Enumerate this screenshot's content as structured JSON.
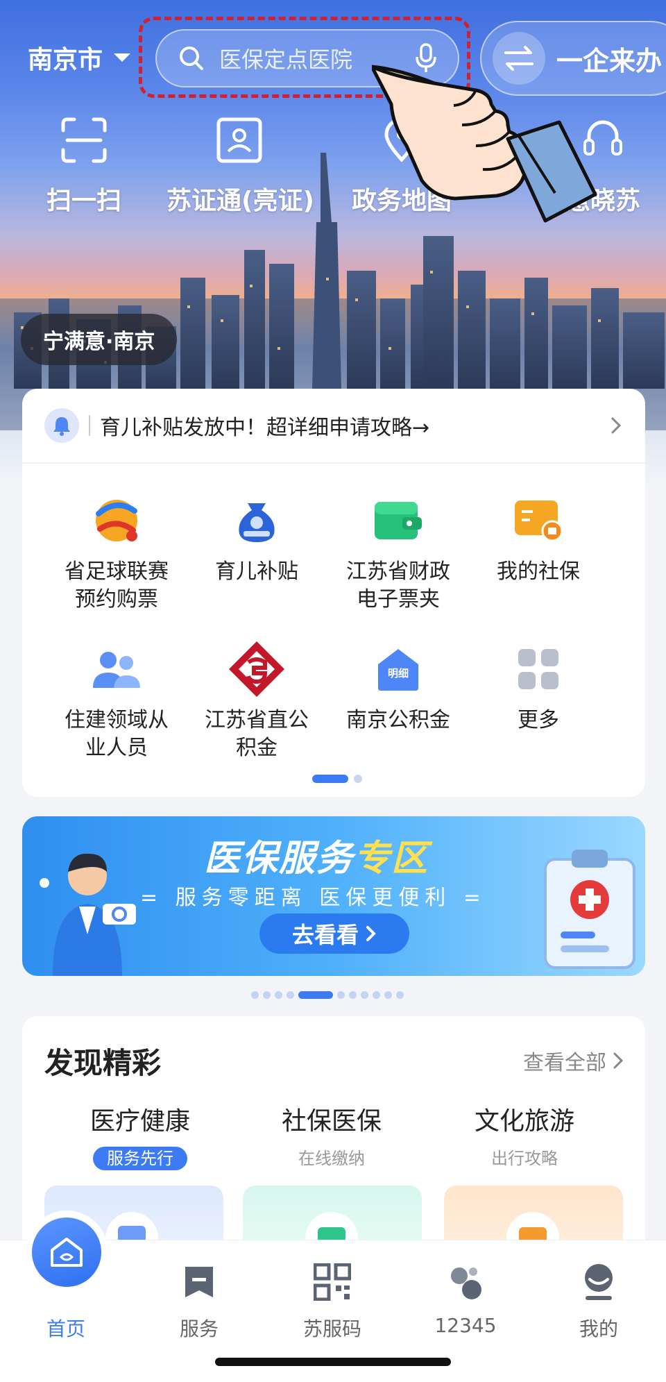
{
  "header": {
    "city": "南京市",
    "search_placeholder": "医保定点医院",
    "enterprise_label": "一企来办"
  },
  "quick_actions": [
    {
      "label": "扫一扫",
      "icon": "scan-icon"
    },
    {
      "label": "苏证通(亮证)",
      "icon": "id-card-icon"
    },
    {
      "label": "政务地图",
      "icon": "map-pin-icon"
    },
    {
      "label": "慧晓苏",
      "icon": "assistant-icon"
    }
  ],
  "slogan": "宁满意·南京",
  "notice": {
    "text": "育儿补贴发放中！超详细申请攻略→"
  },
  "services": [
    {
      "label": "省足球联赛\n预约购票",
      "icon": "football-league-icon"
    },
    {
      "label": "育儿补贴",
      "icon": "childcare-subsidy-icon"
    },
    {
      "label": "江苏省财政\n电子票夹",
      "icon": "wallet-icon"
    },
    {
      "label": "我的社保",
      "icon": "social-security-icon"
    },
    {
      "label": "住建领域从\n业人员",
      "icon": "people-icon"
    },
    {
      "label": "江苏省直公\n积金",
      "icon": "provident-fund-logo-icon"
    },
    {
      "label": "南京公积金",
      "icon": "house-details-icon"
    },
    {
      "label": "更多",
      "icon": "more-grid-icon"
    }
  ],
  "banner": {
    "title_main": "医保服务",
    "title_highlight": "专区",
    "subtitle": "服务零距离  医保更便利",
    "button": "去看看"
  },
  "discover": {
    "title": "发现精彩",
    "view_all": "查看全部",
    "categories": [
      {
        "name": "医疗健康",
        "sub": "服务先行"
      },
      {
        "name": "社保医保",
        "sub": "在线缴纳"
      },
      {
        "name": "文化旅游",
        "sub": "出行攻略"
      }
    ]
  },
  "tabbar": [
    {
      "label": "首页",
      "icon": "home-icon"
    },
    {
      "label": "服务",
      "icon": "service-bookmark-icon"
    },
    {
      "label": "苏服码",
      "icon": "qr-code-icon"
    },
    {
      "label": "12345",
      "icon": "hotline-icon"
    },
    {
      "label": "我的",
      "icon": "profile-icon"
    }
  ],
  "colors": {
    "accent": "#3d7bf5",
    "highlight_outline": "#d3202f",
    "banner_highlight": "#ffe14d"
  }
}
